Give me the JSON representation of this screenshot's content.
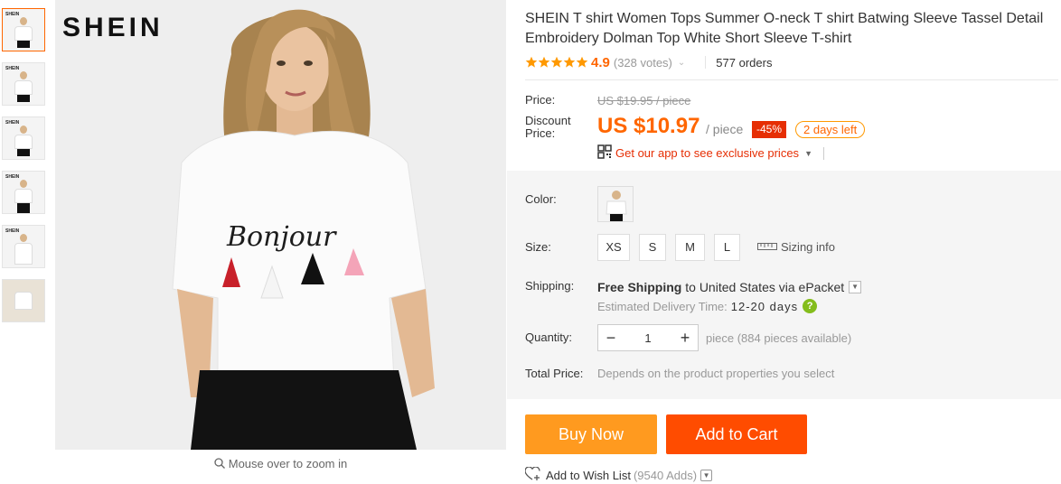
{
  "gallery": {
    "brand": "SHEIN",
    "zoom_hint": "Mouse over to zoom in",
    "thumb_logo": "SHEIN"
  },
  "product": {
    "title": "SHEIN T shirt Women Tops Summer O-neck T shirt Batwing Sleeve Tassel Detail Embroidery Dolman Top White Short Sleeve T-shirt",
    "rating": "4.9",
    "stars": 5,
    "votes": "(328 votes)",
    "orders": "577 orders",
    "shirt_text": "Bonjour"
  },
  "price": {
    "label": "Price:",
    "original": "US $19.95 / piece",
    "discount_label": "Discount Price:",
    "current": "US $10.97",
    "per": "/ piece",
    "discount": "-45%",
    "time_left": "2 days left",
    "app_promo": "Get our app to see exclusive prices"
  },
  "options": {
    "color_label": "Color:",
    "size_label": "Size:",
    "sizes": [
      "XS",
      "S",
      "M",
      "L"
    ],
    "sizing_info": "Sizing info"
  },
  "shipping": {
    "label": "Shipping:",
    "free": "Free Shipping",
    "to": "to",
    "destination": "United States via ePacket",
    "eta_label": "Estimated Delivery Time:",
    "eta_days": "12-20 days"
  },
  "quantity": {
    "label": "Quantity:",
    "value": "1",
    "minus": "−",
    "plus": "+",
    "available": "piece (884 pieces available)"
  },
  "total": {
    "label": "Total Price:",
    "text": "Depends on the product properties you select"
  },
  "actions": {
    "buy_now": "Buy Now",
    "add_to_cart": "Add to Cart",
    "wishlist": "Add to Wish List",
    "wish_count": "(9540 Adds)"
  },
  "colors": {
    "accent": "#ff6600",
    "buy_now_bg": "#ff9a1f",
    "add_cart_bg": "#ff4c00",
    "discount_bg": "#e62e04",
    "star": "#ff9900"
  }
}
